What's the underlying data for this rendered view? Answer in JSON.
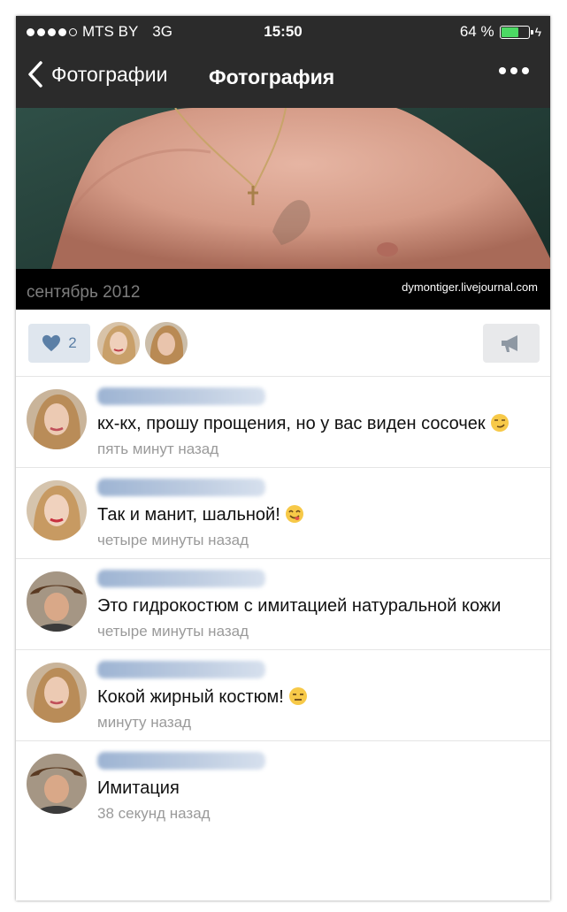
{
  "status_bar": {
    "carrier": "MTS BY",
    "network": "3G",
    "time": "15:50",
    "battery": "64 %",
    "battery_level": 0.64
  },
  "nav": {
    "back_label": "Фотографии",
    "title": "Фотография"
  },
  "photo": {
    "date": "сентябрь 2012",
    "watermark": "dymontiger.livejournal.com"
  },
  "actions": {
    "like_count": "2"
  },
  "comments": [
    {
      "text": "кх-кх, прошу прощения, но у вас виден сосочек",
      "emoji": "smirk-emoji",
      "time": "пять минут назад"
    },
    {
      "text": "Так и манит, шальной!",
      "emoji": "yum-emoji",
      "time": "четыре минуты назад"
    },
    {
      "text": "Это гидрокостюм с имитацией натуральной кожи",
      "emoji": "",
      "time": "четыре минуты назад"
    },
    {
      "text": "Кокой жирный костюм!",
      "emoji": "expressionless-emoji",
      "time": "минуту назад"
    },
    {
      "text": "Имитация",
      "emoji": "",
      "time": "38 секунд назад"
    }
  ],
  "colors": {
    "nav_bg": "#2b2b2b",
    "accent": "#5b7fa6",
    "like_bg": "#dfe6ee",
    "battery": "#4cd964",
    "time_text": "#9a9a9a"
  }
}
